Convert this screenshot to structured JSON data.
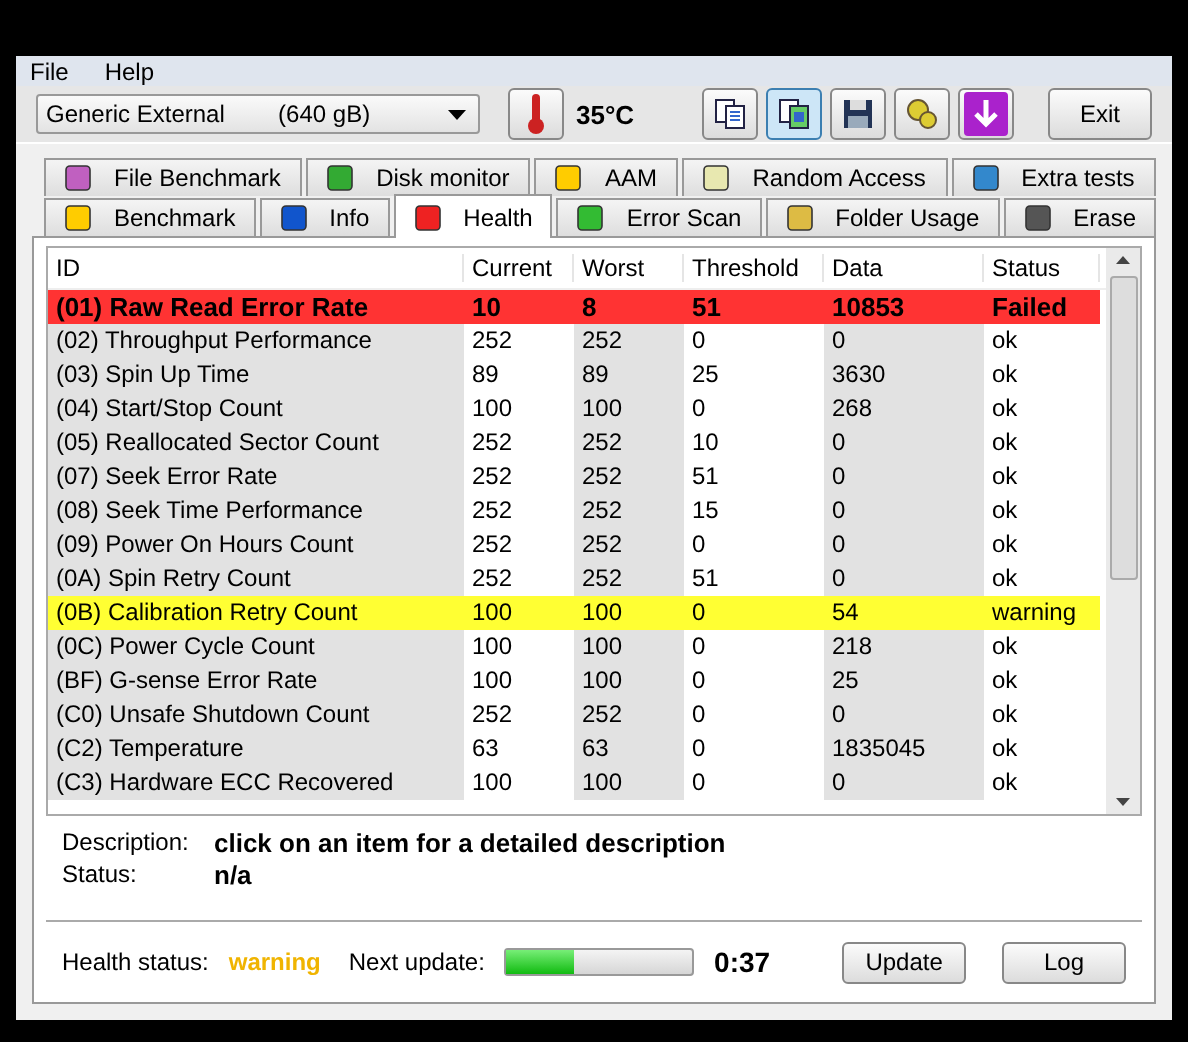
{
  "menu": [
    {
      "label": "File"
    },
    {
      "label": "Help"
    }
  ],
  "toolbar": {
    "drive": "Generic External        (640 gB)",
    "temperature": "35°C",
    "buttons": [
      {
        "selected": false
      },
      {
        "selected": true
      },
      {
        "selected": false
      },
      {
        "selected": false
      },
      {
        "selected": false
      }
    ],
    "exit": "Exit"
  },
  "tab_rows": [
    [
      {
        "label": "File Benchmark",
        "selected": false
      },
      {
        "label": "Disk monitor",
        "selected": false
      },
      {
        "label": "AAM",
        "selected": false
      },
      {
        "label": "Random Access",
        "selected": false
      },
      {
        "label": "Extra tests",
        "selected": false
      }
    ],
    [
      {
        "label": "Benchmark",
        "selected": false
      },
      {
        "label": "Info",
        "selected": false
      },
      {
        "label": "Health",
        "selected": true
      },
      {
        "label": "Error Scan",
        "selected": false
      },
      {
        "label": "Folder Usage",
        "selected": false
      },
      {
        "label": "Erase",
        "selected": false
      }
    ]
  ],
  "table": {
    "columns": [
      "ID",
      "Current",
      "Worst",
      "Threshold",
      "Data",
      "Status"
    ],
    "rows": [
      {
        "kind": "failed",
        "cells": [
          "(01) Raw Read Error Rate",
          "10",
          "8",
          "51",
          "10853",
          "Failed"
        ]
      },
      {
        "kind": "ok",
        "cells": [
          "(02) Throughput Performance",
          "252",
          "252",
          "0",
          "0",
          "ok"
        ]
      },
      {
        "kind": "ok",
        "cells": [
          "(03) Spin Up Time",
          "89",
          "89",
          "25",
          "3630",
          "ok"
        ]
      },
      {
        "kind": "ok",
        "cells": [
          "(04) Start/Stop Count",
          "100",
          "100",
          "0",
          "268",
          "ok"
        ]
      },
      {
        "kind": "ok",
        "cells": [
          "(05) Reallocated Sector Count",
          "252",
          "252",
          "10",
          "0",
          "ok"
        ]
      },
      {
        "kind": "ok",
        "cells": [
          "(07) Seek Error Rate",
          "252",
          "252",
          "51",
          "0",
          "ok"
        ]
      },
      {
        "kind": "ok",
        "cells": [
          "(08) Seek Time Performance",
          "252",
          "252",
          "15",
          "0",
          "ok"
        ]
      },
      {
        "kind": "ok",
        "cells": [
          "(09) Power On Hours Count",
          "252",
          "252",
          "0",
          "0",
          "ok"
        ]
      },
      {
        "kind": "ok",
        "cells": [
          "(0A) Spin Retry Count",
          "252",
          "252",
          "51",
          "0",
          "ok"
        ]
      },
      {
        "kind": "warning",
        "cells": [
          "(0B) Calibration Retry Count",
          "100",
          "100",
          "0",
          "54",
          "warning"
        ]
      },
      {
        "kind": "ok",
        "cells": [
          "(0C) Power Cycle Count",
          "100",
          "100",
          "0",
          "218",
          "ok"
        ]
      },
      {
        "kind": "ok",
        "cells": [
          "(BF) G-sense Error Rate",
          "100",
          "100",
          "0",
          "25",
          "ok"
        ]
      },
      {
        "kind": "ok",
        "cells": [
          "(C0) Unsafe Shutdown Count",
          "252",
          "252",
          "0",
          "0",
          "ok"
        ]
      },
      {
        "kind": "ok",
        "cells": [
          "(C2) Temperature",
          "63",
          "63",
          "0",
          "1835045",
          "ok"
        ]
      },
      {
        "kind": "ok",
        "cells": [
          "(C3) Hardware ECC Recovered",
          "100",
          "100",
          "0",
          "0",
          "ok"
        ]
      }
    ]
  },
  "details": [
    {
      "label": "Description:",
      "value": "click on an item for a detailed description"
    },
    {
      "label": "Status:",
      "value": "n/a"
    }
  ],
  "footer": {
    "health_label": "Health status:",
    "health_value": "warning",
    "update_label": "Next update:",
    "level": 0.36,
    "countdown": "0:37",
    "buttons": [
      "Update",
      "Log"
    ]
  }
}
